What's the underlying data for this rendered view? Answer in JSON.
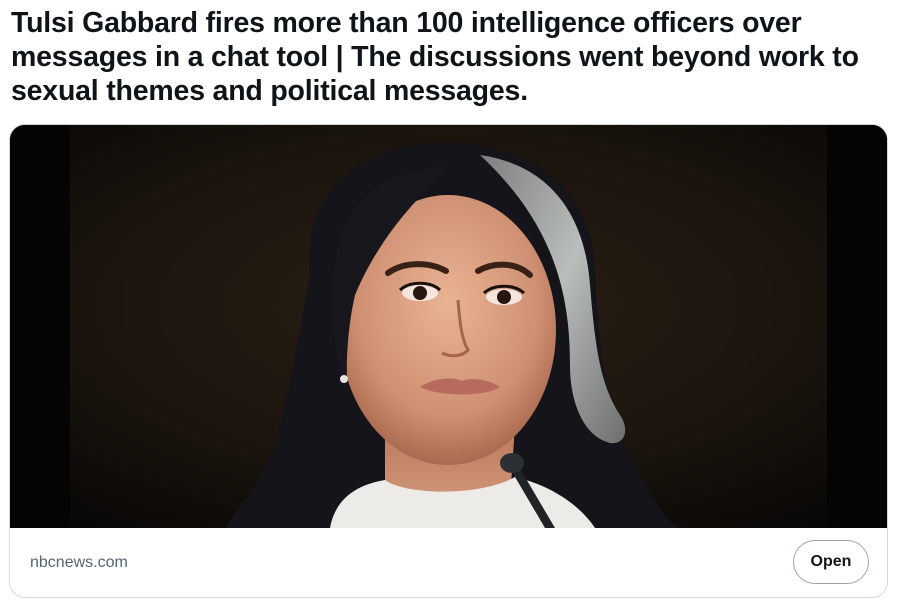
{
  "post": {
    "headline": "Tulsi Gabbard fires more than 100 intelligence officers over messages in a chat tool | The discussions went beyond work to sexual themes and political messages."
  },
  "card": {
    "image_alt": "Portrait of Tulsi Gabbard",
    "domain": "nbcnews.com",
    "open_label": "Open"
  }
}
